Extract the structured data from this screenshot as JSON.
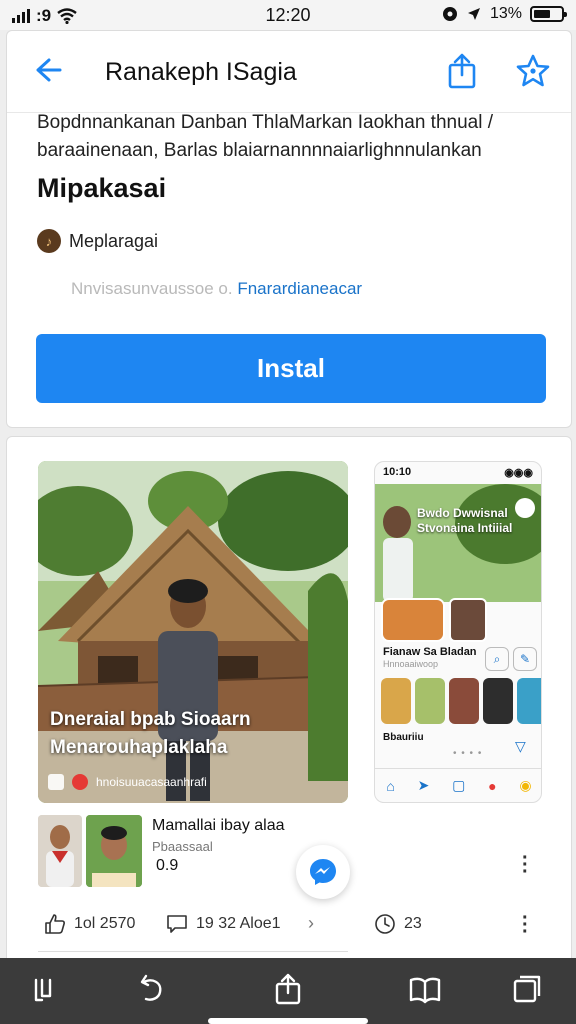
{
  "status_bar": {
    "carrier_text": ":9",
    "time": "12:20",
    "battery_text": "13%",
    "icons": [
      "signal-icon",
      "wifi-icon",
      "location-icon",
      "battery-icon"
    ]
  },
  "header": {
    "title": "Ranakeph ISagia",
    "icons": [
      "back-arrow-icon",
      "share-icon",
      "favorite-star-icon"
    ],
    "accent_color": "#1e86f2"
  },
  "description": {
    "line1": "Bopdnnankanan Danban ThlaMarkan Iaokhan thnual /",
    "line2": "baraainenaan, Barlas blaiarnannnnaiarlighnnulankan"
  },
  "app": {
    "name": "Mipakasai",
    "developer": "Meplaragai",
    "info_muted": "Nnvisasunvaussoe o.",
    "info_link": "Fnarardianeacar",
    "install_label": "Instal"
  },
  "screenshots": {
    "shot1": {
      "caption_line1": "Dneraial bpab Sioaarn",
      "caption_line2": "Menarouhaplaklaha",
      "bar_text": "hnoisuuacasaanhrafi"
    },
    "shot2": {
      "status_left": "10:10",
      "status_right": "◉◉◉",
      "hero_text": "Bwdo Dwwisnal Stvonaina Intiiial",
      "label": "Fianaw Sa Bladan",
      "sublabel": "Hnnoaaiwoop",
      "meta": "Bbauriiu",
      "dots": "• • • •"
    }
  },
  "listing": {
    "title": "Mamallai ibay alaa",
    "subtitle": "Pbaassaal",
    "rating": "0.9"
  },
  "stats": {
    "likes": "1ol 2570",
    "comments": "19 32 Aloe1",
    "time": "23"
  },
  "toolbar": {
    "icons": [
      "tabs-icon",
      "undo-icon",
      "share-icon",
      "bookmarks-icon",
      "copy-icon"
    ]
  }
}
